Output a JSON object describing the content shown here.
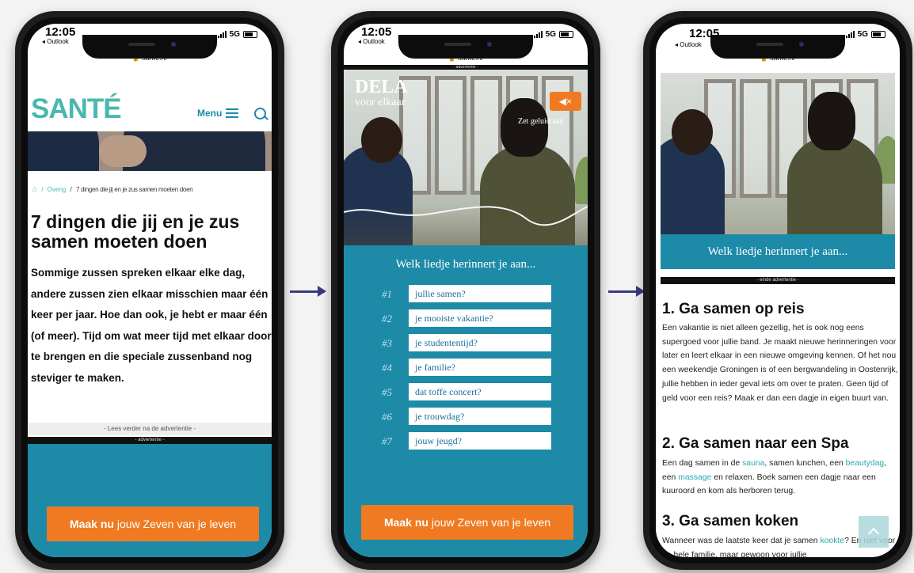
{
  "statusbar": {
    "time": "12:05",
    "back": "◂ Outlook",
    "network": "5G",
    "url": "sante.nl"
  },
  "phone1": {
    "logo": "SANTÉ",
    "menu_label": "Menu",
    "breadcrumb": {
      "sep": "/",
      "category": "Overig",
      "current": "7 dingen die jij en je zus samen moeten doen"
    },
    "title": "7 dingen die jij en je zus samen moeten doen",
    "intro": "Sommige zussen spreken elkaar elke dag, andere zussen zien elkaar misschien maar één keer per jaar. Hoe dan ook, je hebt er maar één (of meer). Tijd om wat meer tijd met elkaar door te brengen en die speciale zussenband nog steviger te maken.",
    "read_more": "- Lees verder na de advertentie -",
    "ad_label": "- advertentie -",
    "cta_bold": "Maak nu",
    "cta_rest": "jouw Zeven van je leven"
  },
  "phone2": {
    "ad_label": "- advertentie -",
    "brand_name": "DELA",
    "brand_sub": "voor elkaar",
    "sound_label": "Zet geluid aan",
    "question": "Welk liedje herinnert je aan...",
    "options": [
      {
        "num": "#1",
        "text": "jullie samen?"
      },
      {
        "num": "#2",
        "text": "je mooiste vakantie?"
      },
      {
        "num": "#3",
        "text": "je studententijd?"
      },
      {
        "num": "#4",
        "text": "je familie?"
      },
      {
        "num": "#5",
        "text": "dat toffe concert?"
      },
      {
        "num": "#6",
        "text": "je trouwdag?"
      },
      {
        "num": "#7",
        "text": "jouw jeugd?"
      }
    ],
    "cta_bold": "Maak nu",
    "cta_rest": "jouw Zeven van je leven"
  },
  "phone3": {
    "question": "Welk liedje herinnert je aan...",
    "end_ad": "- einde advertentie -",
    "sections": [
      {
        "title": "1. Ga samen op reis",
        "text": "Een vakantie is niet alleen gezellig, het is ook nog eens supergoed voor jullie band. Je maakt nieuwe herinneringen voor later en leert elkaar in een nieuwe omgeving kennen. Of het nou een weekendje Groningen is of een bergwandeling in Oostenrijk, jullie hebben in ieder geval iets om over te praten. Geen tijd of geld voor een reis? Maak er dan een dagje in eigen buurt van."
      },
      {
        "title": "2. Ga samen naar een Spa",
        "t1": "Een dag samen in de ",
        "l1": "sauna",
        "t2": ", samen lunchen, een ",
        "l2": "beautydag",
        "t3": ", een ",
        "l3": "massage",
        "t4": " en relaxen. Boek samen een dagje naar een kuuroord en kom als herboren terug."
      },
      {
        "title": "3. Ga samen koken",
        "t1": "Wanneer was de laatste keer dat je samen ",
        "l1": "kookte",
        "t2": "? En niet voor de hele familie, maar gewoon voor jullie"
      }
    ]
  },
  "colors": {
    "teal": "#1d8aa8",
    "logo": "#4bb7b0",
    "orange": "#f07a21",
    "arrow": "#3c3a7e",
    "link": "#2aa9b5"
  }
}
